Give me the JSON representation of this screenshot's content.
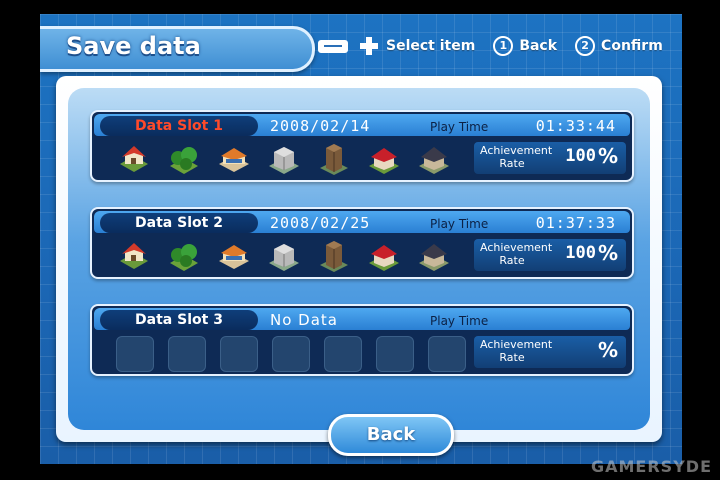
{
  "header": {
    "title": "Save data"
  },
  "hints": [
    {
      "button": "plus",
      "label": "Select item"
    },
    {
      "button": "1",
      "label": "Back"
    },
    {
      "button": "2",
      "label": "Confirm"
    }
  ],
  "slots": [
    {
      "label": "Data Slot 1",
      "date": "2008/02/14",
      "playtime_label": "Play Time",
      "playtime": "01:33:44",
      "achievement_label": "Achievement Rate",
      "achievement_value": "100",
      "achievement_unit": "%",
      "active": true
    },
    {
      "label": "Data Slot 2",
      "date": "2008/02/25",
      "playtime_label": "Play Time",
      "playtime": "01:37:33",
      "achievement_label": "Achievement Rate",
      "achievement_value": "100",
      "achievement_unit": "%",
      "active": false
    },
    {
      "label": "Data Slot 3",
      "date": "No Data",
      "playtime_label": "Play Time",
      "playtime": "",
      "achievement_label": "Achievement Rate",
      "achievement_value": "",
      "achievement_unit": "%",
      "active": false
    }
  ],
  "buildings": [
    "red-roof-house-icon",
    "trees-icon",
    "shop-icon",
    "grey-building-icon",
    "tower-building-icon",
    "red-barn-icon",
    "dark-house-icon"
  ],
  "back_button": "Back",
  "watermark": "GAMERSYDE",
  "colors": {
    "active_slot_label": "#ff4a2a",
    "panel_blue": "#2f86d8"
  }
}
